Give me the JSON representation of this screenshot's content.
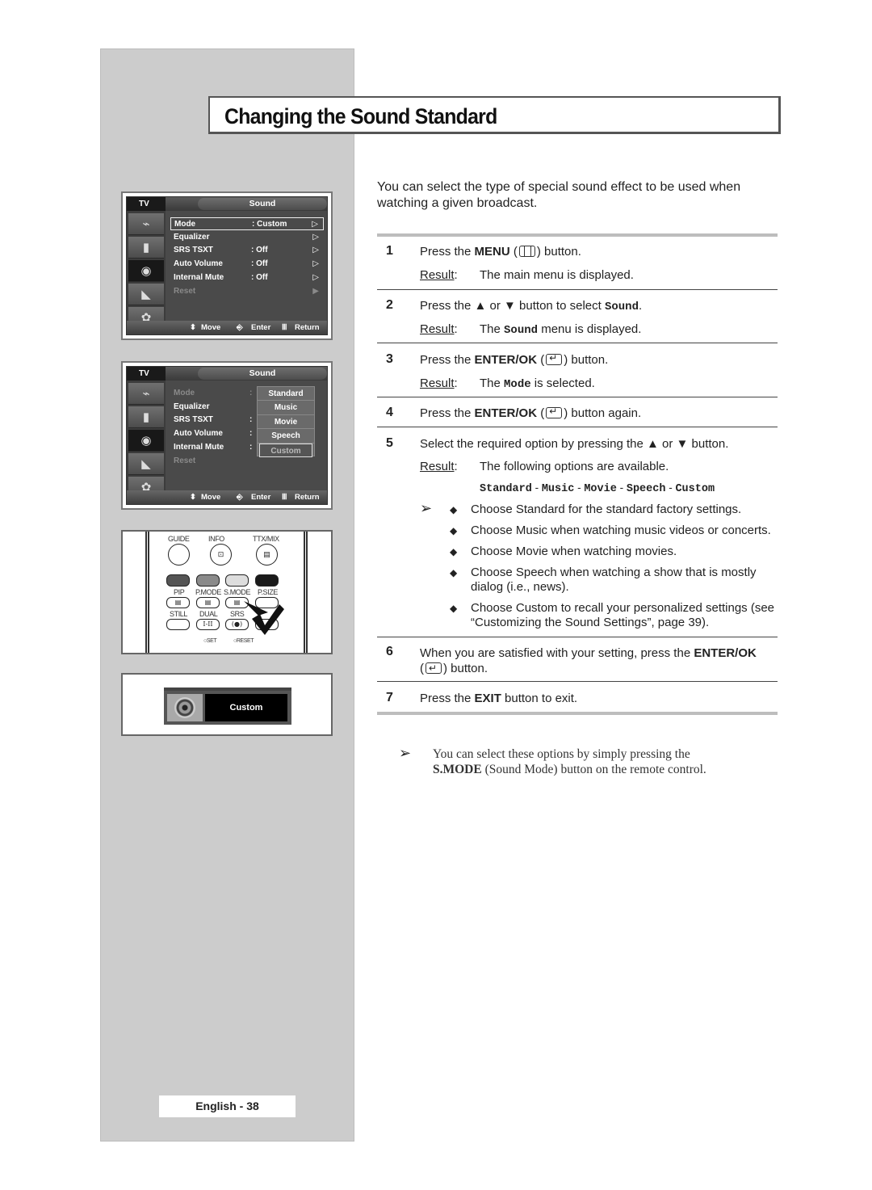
{
  "title": "Changing the Sound Standard",
  "page_label": "English - 38",
  "intro": "You can select the type of special sound effect to be used when watching a given broadcast.",
  "osd1": {
    "tv_label": "TV",
    "tab": "Sound",
    "rows": [
      {
        "label": "Mode",
        "value": ": Custom",
        "arrow": "▷",
        "selected": true,
        "dim": false
      },
      {
        "label": "Equalizer",
        "value": "",
        "arrow": "▷",
        "selected": false,
        "dim": false
      },
      {
        "label": "SRS TSXT",
        "value": ": Off",
        "arrow": "▷",
        "selected": false,
        "dim": false
      },
      {
        "label": "Auto Volume",
        "value": ": Off",
        "arrow": "▷",
        "selected": false,
        "dim": false
      },
      {
        "label": "Internal Mute",
        "value": ": Off",
        "arrow": "▷",
        "selected": false,
        "dim": false
      },
      {
        "label": "Reset",
        "value": "",
        "arrow": "▶",
        "selected": false,
        "dim": true
      }
    ],
    "footer": {
      "move": "Move",
      "enter": "Enter",
      "return": "Return"
    }
  },
  "osd2": {
    "tv_label": "TV",
    "tab": "Sound",
    "rows": [
      {
        "label": "Mode",
        "colon": ":",
        "dim": true
      },
      {
        "label": "Equalizer",
        "colon": "",
        "dim": false
      },
      {
        "label": "SRS TSXT",
        "colon": ":",
        "dim": false
      },
      {
        "label": "Auto Volume",
        "colon": ":",
        "dim": false
      },
      {
        "label": "Internal Mute",
        "colon": ":",
        "dim": false
      },
      {
        "label": "Reset",
        "colon": "",
        "dim": true
      }
    ],
    "popup_options": [
      "Standard",
      "Music",
      "Movie",
      "Speech",
      "Custom"
    ],
    "popup_current": "Custom",
    "footer": {
      "move": "Move",
      "enter": "Enter",
      "return": "Return"
    }
  },
  "remote": {
    "top_labels": [
      "GUIDE",
      "INFO",
      "TTX/MIX"
    ],
    "mid_labels": [
      "PIP",
      "P.MODE",
      "S.MODE",
      "P.SIZE"
    ],
    "bottom_labels": [
      "STILL",
      "DUAL",
      "SRS"
    ],
    "dual_button": "I-II",
    "set_label": "SET",
    "reset_label": "RESET",
    "color_keys": [
      "#555555",
      "#8a8a8a",
      "#dddddd",
      "#1a1a1a"
    ]
  },
  "osd3": {
    "label": "Custom"
  },
  "steps": [
    {
      "num": "1",
      "pre": "Press the ",
      "bold": "MENU",
      "icon": "menu",
      "post": ") button.",
      "result": "The main menu is displayed."
    },
    {
      "num": "2",
      "text_a": "Press the ▲ or ▼ button to select ",
      "mono": "Sound",
      "text_b": ".",
      "result_a": "The ",
      "result_mono": "Sound",
      "result_b": " menu is displayed."
    },
    {
      "num": "3",
      "pre": "Press the ",
      "bold": "ENTER/OK",
      "icon": "enter",
      "post": ") button.",
      "result_a": "The ",
      "result_mono": "Mode",
      "result_b": " is selected."
    },
    {
      "num": "4",
      "pre": "Press the ",
      "bold": "ENTER/OK",
      "icon": "enter",
      "post": ") button again."
    },
    {
      "num": "5",
      "text": "Select the required option by pressing the ▲ or ▼ button.",
      "result": "The following options are available.",
      "options": [
        "Standard",
        "Music",
        "Movie",
        "Speech",
        "Custom"
      ],
      "bullets": [
        "Choose Standard for the standard factory settings.",
        "Choose Music when watching music videos or concerts.",
        "Choose Movie when watching movies.",
        "Choose Speech when watching a show that is mostly dialog (i.e., news).",
        "Choose Custom to recall your personalized settings (see “Customizing the Sound Settings”, page 39)."
      ]
    },
    {
      "num": "6",
      "pre": "When you are satisfied with your setting, press the ",
      "bold": "ENTER/OK",
      "post": ") button."
    },
    {
      "num": "7",
      "pre": "Press the ",
      "bold": "EXIT",
      "post": " button to exit."
    }
  ],
  "result_label": "Result",
  "tip": {
    "pre": "You can select these options by simply pressing the ",
    "bold": "S.MODE",
    "post": " (Sound Mode) button on the remote control."
  },
  "glyphs": {
    "note_arrow": "➢",
    "bullet": "◆",
    "open_paren": "(",
    "colon": ":",
    "dash": " - "
  }
}
